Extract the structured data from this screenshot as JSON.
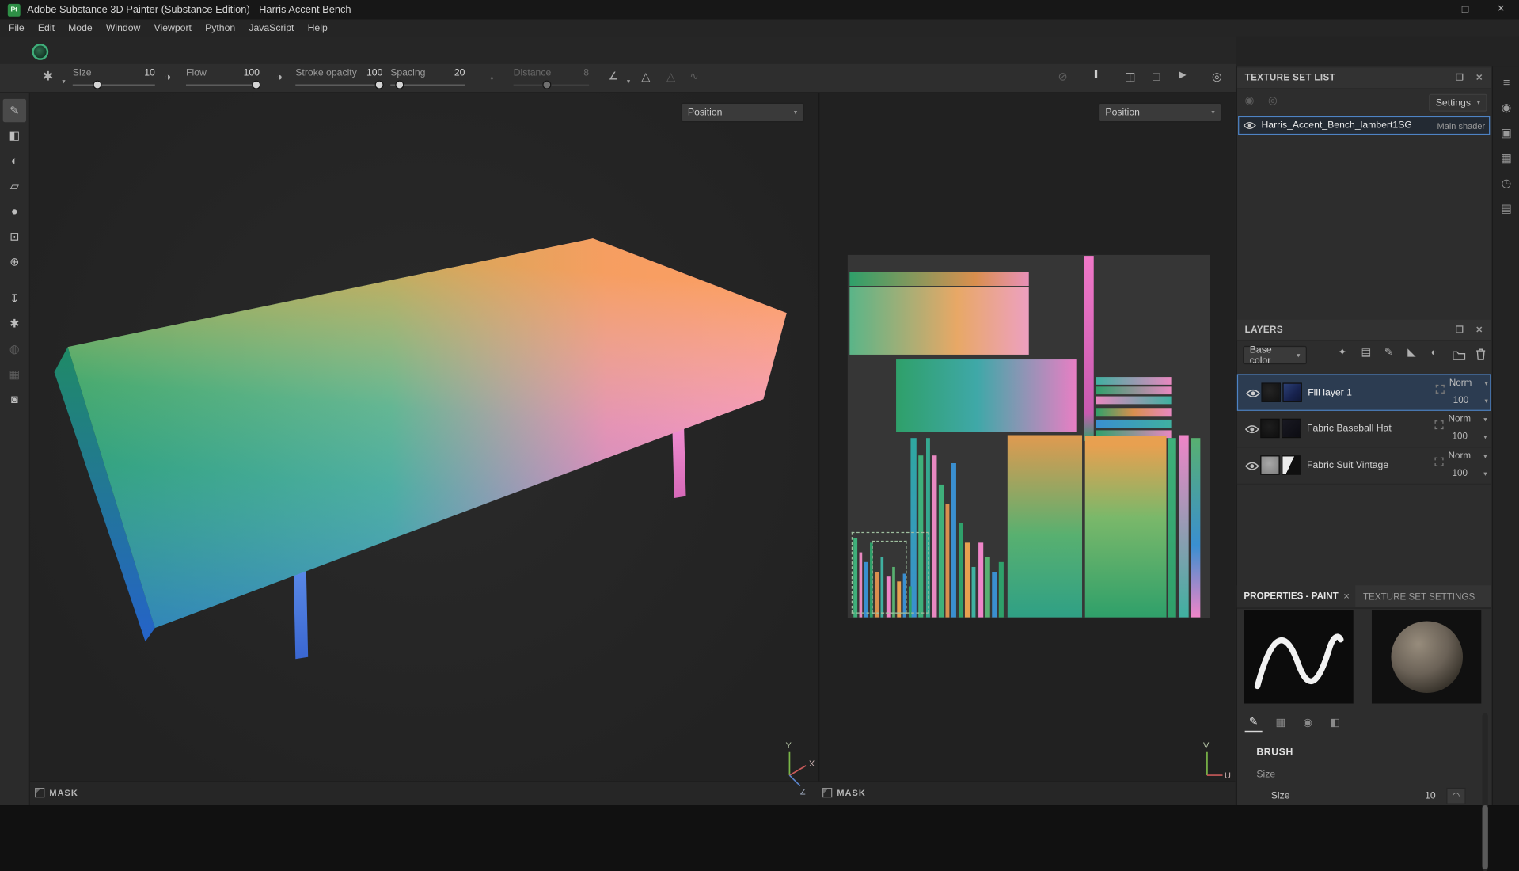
{
  "window": {
    "title": "Adobe Substance 3D Painter (Substance Edition) - Harris Accent Bench",
    "logo": "Pt",
    "minimize": "–",
    "maximize": "❐",
    "close": "✕"
  },
  "menus": {
    "items": [
      "File",
      "Edit",
      "Mode",
      "Window",
      "Viewport",
      "Python",
      "JavaScript",
      "Help"
    ]
  },
  "tool_options": {
    "size": {
      "label": "Size",
      "value": "10"
    },
    "flow": {
      "label": "Flow",
      "value": "100"
    },
    "stroke_opacity": {
      "label": "Stroke opacity",
      "value": "100"
    },
    "spacing": {
      "label": "Spacing",
      "value": "20"
    },
    "distance": {
      "label": "Distance",
      "value": "8"
    }
  },
  "viewport3d": {
    "channel": "Position",
    "mask": "MASK",
    "axis_y": "Y",
    "axis_x": "X",
    "axis_z": "Z"
  },
  "viewport2d": {
    "channel": "Position",
    "mask": "MASK",
    "axis_v": "V",
    "axis_u": "U"
  },
  "texture_set_list": {
    "title": "TEXTURE SET LIST",
    "settings": "Settings",
    "shader_name": "Harris_Accent_Bench_lambert1SG",
    "shader_badge": "Main shader"
  },
  "layers": {
    "title": "LAYERS",
    "channel_filter": "Base color",
    "rows": [
      {
        "name": "Fill layer 1",
        "blend": "Norm",
        "opacity": "100"
      },
      {
        "name": "Fabric Baseball Hat",
        "blend": "Norm",
        "opacity": "100"
      },
      {
        "name": "Fabric Suit Vintage",
        "blend": "Norm",
        "opacity": "100"
      }
    ]
  },
  "properties": {
    "tab_paint": "PROPERTIES - PAINT",
    "tab_texture": "TEXTURE SET SETTINGS",
    "section": "BRUSH",
    "group_size": "Size",
    "size_label": "Size",
    "size_value": "10"
  },
  "colors": {
    "accent_blue": "#4e83c4",
    "logo_green": "#2e8f46"
  },
  "icons": {
    "chevron": "▾",
    "brush_stamp": "✱",
    "falloff": "◑",
    "dot": "•",
    "angle": "∠",
    "symmetry": "△",
    "lazy": "∿",
    "hide_ui": "⊘",
    "pause": "‖",
    "split": "◫",
    "persp": "□",
    "video": "▶",
    "camera": "◎",
    "detach": "❐",
    "close": "✕",
    "pressure": "◠",
    "tools": [
      "✎",
      "◧",
      "◐",
      "▱",
      "●",
      "⊡",
      "⊕",
      "↧",
      "✱",
      "◍",
      "▦",
      "◙"
    ],
    "layer_ops": [
      "✦",
      "▤",
      "✎",
      "◣",
      "◐"
    ],
    "subtabs": [
      "✎",
      "▦",
      "◉",
      "◧"
    ],
    "rail": [
      "≡",
      "◉",
      "▣",
      "▦",
      "◷",
      "▤"
    ],
    "ts_toggles": [
      "◉",
      "◎"
    ]
  }
}
